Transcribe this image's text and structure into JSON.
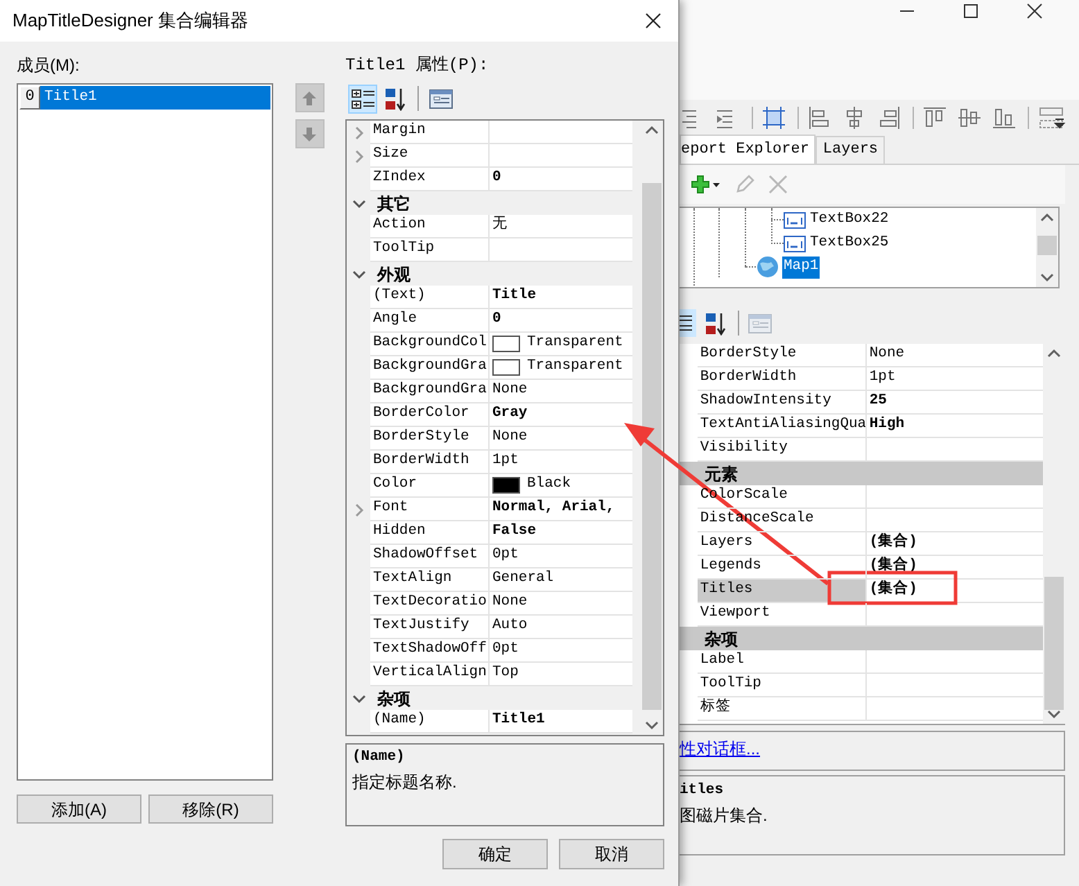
{
  "background_window": {
    "tabs": [
      {
        "label": "eport Explorer",
        "selected": true
      },
      {
        "label": "Layers",
        "selected": false
      }
    ],
    "tree": [
      {
        "kind": "textbox",
        "label": "TextBox22",
        "selected": false
      },
      {
        "kind": "textbox",
        "label": "TextBox25",
        "selected": false
      },
      {
        "kind": "map",
        "label": "Map1",
        "selected": true
      }
    ],
    "grid": [
      {
        "kind": "property",
        "name": "BorderStyle",
        "value": "None",
        "bold": false,
        "selected": false
      },
      {
        "kind": "property",
        "name": "BorderWidth",
        "value": "1pt",
        "bold": false,
        "selected": false
      },
      {
        "kind": "property",
        "name": "ShadowIntensity",
        "value": "25",
        "bold": true,
        "selected": false
      },
      {
        "kind": "property",
        "name": "TextAntiAliasingQua",
        "value": "High",
        "bold": true,
        "selected": false
      },
      {
        "kind": "property",
        "name": "Visibility",
        "selected": false
      },
      {
        "kind": "category",
        "name": "元素"
      },
      {
        "kind": "property",
        "name": "ColorScale",
        "selected": false
      },
      {
        "kind": "property",
        "name": "DistanceScale",
        "selected": false
      },
      {
        "kind": "property",
        "name": "Layers",
        "value": "(集合)",
        "bold": true,
        "selected": false
      },
      {
        "kind": "property",
        "name": "Legends",
        "value": "(集合)",
        "bold": true,
        "selected": false
      },
      {
        "kind": "property",
        "name": "Titles",
        "value": "(集合)",
        "bold": true,
        "selected": true
      },
      {
        "kind": "property",
        "name": "Viewport",
        "selected": false
      },
      {
        "kind": "category",
        "name": "杂项"
      },
      {
        "kind": "property",
        "name": "Label",
        "selected": false
      },
      {
        "kind": "property",
        "name": "ToolTip",
        "selected": false
      },
      {
        "kind": "property",
        "name": "标签",
        "selected": false
      }
    ],
    "link": "性对话框...",
    "description": {
      "title": "itles",
      "text": "图磁片集合."
    }
  },
  "dialog": {
    "title": "MapTitleDesigner 集合编辑器",
    "members_label": "成员(M):",
    "members": [
      {
        "index": "0",
        "name": "Title1",
        "selected": true
      }
    ],
    "move_buttons": [
      {
        "kind": "up",
        "disabled": true
      },
      {
        "kind": "down",
        "disabled": true
      }
    ],
    "properties_label": "Title1 属性(P):",
    "toolbar": [
      {
        "kind": "categorized",
        "selected": true
      },
      {
        "kind": "alphabetical",
        "selected": false
      },
      {
        "kind": "pages",
        "selected": false
      }
    ],
    "grid": [
      {
        "kind": "property",
        "name": "Margin",
        "expandable": true
      },
      {
        "kind": "property",
        "name": "Size",
        "expandable": true
      },
      {
        "kind": "property",
        "name": "ZIndex",
        "value": "0",
        "expandable": false,
        "bold": true
      },
      {
        "kind": "category",
        "name": "其它",
        "expanded": true
      },
      {
        "kind": "property",
        "name": "Action",
        "value": "无",
        "expandable": false,
        "bold": false
      },
      {
        "kind": "property",
        "name": "ToolTip",
        "expandable": false
      },
      {
        "kind": "category",
        "name": "外观",
        "expanded": true
      },
      {
        "kind": "property",
        "name": "(Text)",
        "value": "Title",
        "expandable": false,
        "bold": true
      },
      {
        "kind": "property",
        "name": "Angle",
        "value": "0",
        "expandable": false,
        "bold": true
      },
      {
        "kind": "property",
        "name": "BackgroundCol",
        "value": "Transparent",
        "color": "#ffffff",
        "expandable": false,
        "bold": false
      },
      {
        "kind": "property",
        "name": "BackgroundGra",
        "value": "Transparent",
        "color": "#ffffff",
        "expandable": false,
        "bold": false
      },
      {
        "kind": "property",
        "name": "BackgroundGra",
        "value": "None",
        "expandable": false,
        "bold": false
      },
      {
        "kind": "property",
        "name": "BorderColor",
        "value": "Gray",
        "expandable": false,
        "bold": true
      },
      {
        "kind": "property",
        "name": "BorderStyle",
        "value": "None",
        "expandable": false,
        "bold": false
      },
      {
        "kind": "property",
        "name": "BorderWidth",
        "value": "1pt",
        "expandable": false,
        "bold": false
      },
      {
        "kind": "property",
        "name": "Color",
        "value": "Black",
        "color": "#000000",
        "expandable": false,
        "bold": false
      },
      {
        "kind": "property",
        "name": "Font",
        "value": "Normal, Arial,",
        "expandable": true,
        "bold": true
      },
      {
        "kind": "property",
        "name": "Hidden",
        "value": "False",
        "expandable": false,
        "bold": true
      },
      {
        "kind": "property",
        "name": "ShadowOffset",
        "value": "0pt",
        "expandable": false,
        "bold": false
      },
      {
        "kind": "property",
        "name": "TextAlign",
        "value": "General",
        "expandable": false,
        "bold": false
      },
      {
        "kind": "property",
        "name": "TextDecoratio",
        "value": "None",
        "expandable": false,
        "bold": false
      },
      {
        "kind": "property",
        "name": "TextJustify",
        "value": "Auto",
        "expandable": false,
        "bold": false
      },
      {
        "kind": "property",
        "name": "TextShadowOff",
        "value": "0pt",
        "expandable": false,
        "bold": false
      },
      {
        "kind": "property",
        "name": "VerticalAlign",
        "value": "Top",
        "expandable": false,
        "bold": false
      },
      {
        "kind": "category",
        "name": "杂项",
        "expanded": true
      },
      {
        "kind": "property",
        "name": "(Name)",
        "value": "Title1",
        "expandable": false,
        "bold": true
      }
    ],
    "description": {
      "title": "(Name)",
      "text": "指定标题名称."
    },
    "buttons_left": [
      "添加(A)",
      "移除(R)"
    ],
    "buttons_right": [
      "确定",
      "取消"
    ]
  }
}
